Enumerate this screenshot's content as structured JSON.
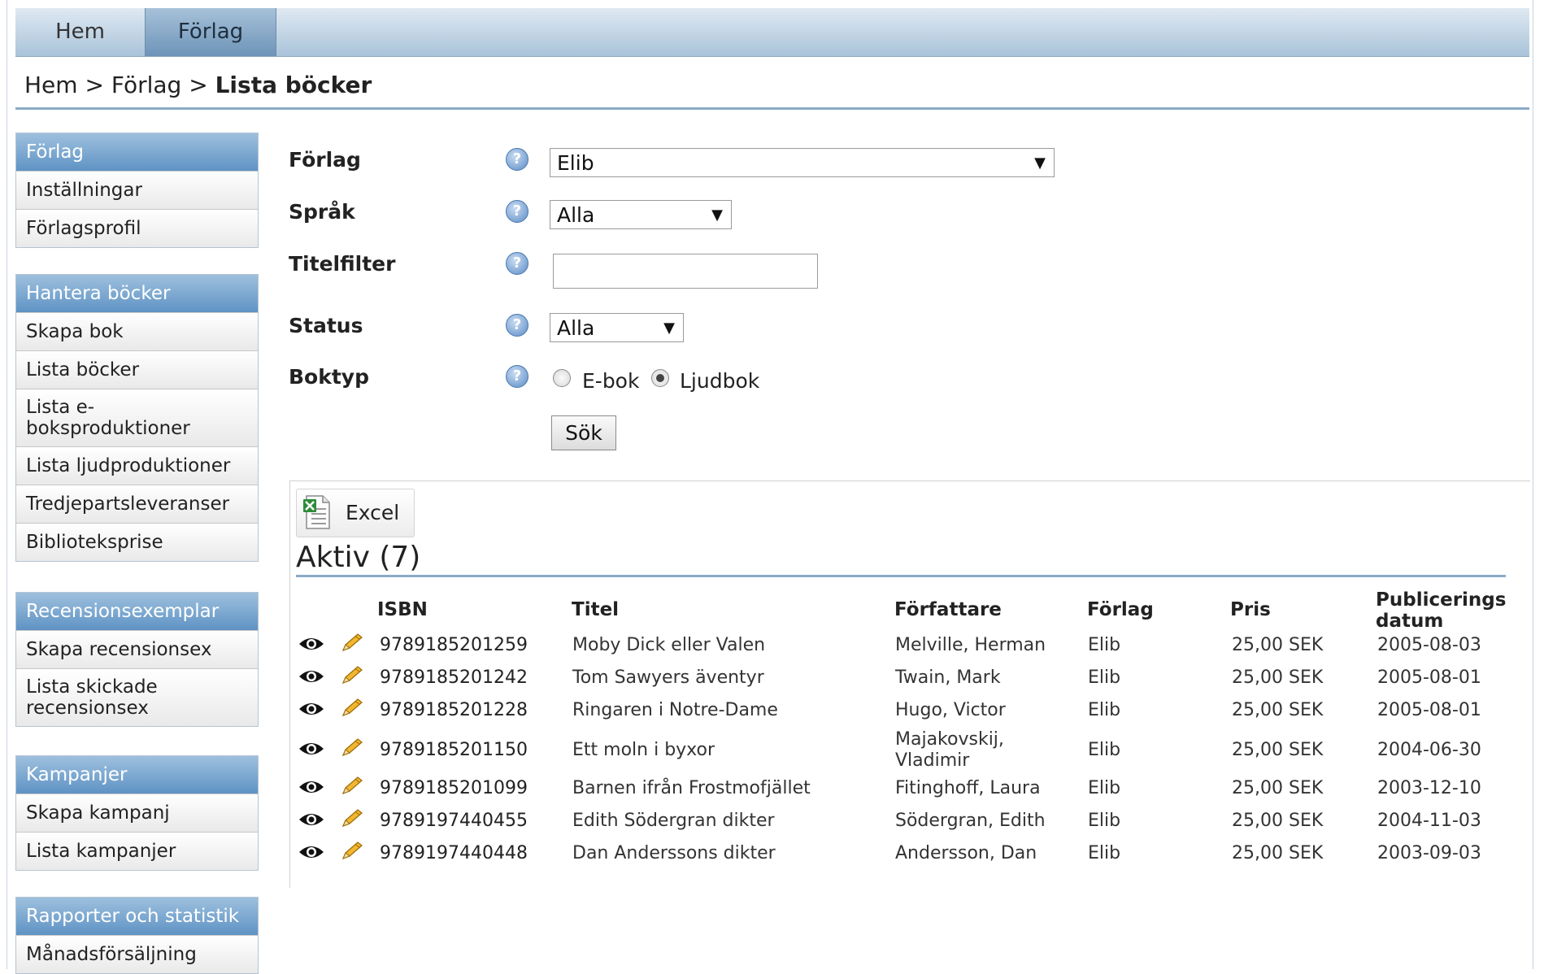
{
  "nav": {
    "tabs": [
      "Hem",
      "Förlag"
    ]
  },
  "breadcrumb": {
    "home": "Hem",
    "sep1": ">",
    "forlag": "Förlag",
    "sep2": ">",
    "current": "Lista böcker"
  },
  "sidebar": {
    "groups": [
      {
        "title": "Förlag",
        "items": [
          "Inställningar",
          "Förlagsprofil"
        ]
      },
      {
        "title": "Hantera böcker",
        "items": [
          "Skapa bok",
          "Lista böcker",
          "Lista e-boksproduktioner",
          "Lista ljudproduktioner",
          "Tredjepartsleveranser",
          "Biblioteksprise"
        ]
      },
      {
        "title": "Recensionsexemplar",
        "items": [
          "Skapa recensionsex",
          "Lista skickade recensionsex"
        ]
      },
      {
        "title": "Kampanjer",
        "items": [
          "Skapa kampanj",
          "Lista kampanjer"
        ]
      },
      {
        "title": "Rapporter och statistik",
        "items": [
          "Månadsförsäljning"
        ]
      }
    ]
  },
  "form": {
    "forlag": {
      "label": "Förlag",
      "value": "Elib"
    },
    "sprak": {
      "label": "Språk",
      "value": "Alla"
    },
    "titelfilter": {
      "label": "Titelfilter",
      "value": ""
    },
    "status": {
      "label": "Status",
      "value": "Alla"
    },
    "boktyp": {
      "label": "Boktyp",
      "options": [
        "E-bok",
        "Ljudbok"
      ],
      "selected": "Ljudbok"
    },
    "search_label": "Sök",
    "arrow": "▼",
    "help": "?"
  },
  "results": {
    "excel_label": "Excel",
    "title": "Aktiv (7)",
    "columns": {
      "isbn": "ISBN",
      "titel": "Titel",
      "forfattare": "Författare",
      "forlag": "Förlag",
      "pris": "Pris",
      "pub1": "Publicerings",
      "pub2": "datum"
    },
    "rows": [
      {
        "isbn": "9789185201259",
        "titel": "Moby Dick eller Valen",
        "forfattare": "Melville, Herman",
        "forlag": "Elib",
        "pris": "25,00 SEK",
        "datum": "2005-08-03"
      },
      {
        "isbn": "9789185201242",
        "titel": "Tom Sawyers äventyr",
        "forfattare": "Twain, Mark",
        "forlag": "Elib",
        "pris": "25,00 SEK",
        "datum": "2005-08-01"
      },
      {
        "isbn": "9789185201228",
        "titel": "Ringaren i Notre-Dame",
        "forfattare": "Hugo, Victor",
        "forlag": "Elib",
        "pris": "25,00 SEK",
        "datum": "2005-08-01"
      },
      {
        "isbn": "9789185201150",
        "titel": "Ett moln i byxor",
        "forfattare": "Majakovskij, Vladimir",
        "forlag": "Elib",
        "pris": "25,00 SEK",
        "datum": "2004-06-30"
      },
      {
        "isbn": "9789185201099",
        "titel": "Barnen ifrån Frostmofjället",
        "forfattare": "Fitinghoff, Laura",
        "forlag": "Elib",
        "pris": "25,00 SEK",
        "datum": "2003-12-10"
      },
      {
        "isbn": "9789197440455",
        "titel": "Edith Södergran dikter",
        "forfattare": "Södergran, Edith",
        "forlag": "Elib",
        "pris": "25,00 SEK",
        "datum": "2004-11-03"
      },
      {
        "isbn": "9789197440448",
        "titel": "Dan Anderssons dikter",
        "forfattare": "Andersson, Dan",
        "forlag": "Elib",
        "pris": "25,00 SEK",
        "datum": "2003-09-03"
      }
    ]
  }
}
